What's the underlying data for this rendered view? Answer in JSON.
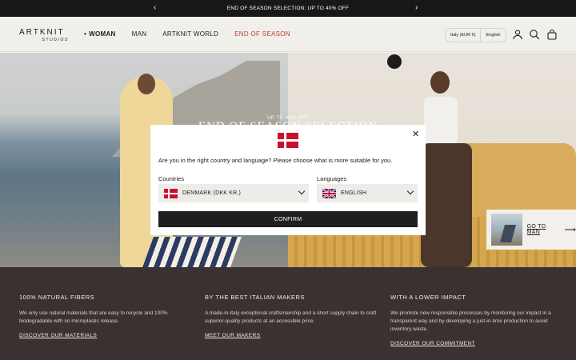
{
  "announcement": {
    "text": "END OF SEASON SELECTION: UP TO 40% OFF",
    "prev_icon": "chevron-left-icon",
    "next_icon": "chevron-right-icon",
    "prev_glyph": "‹",
    "next_glyph": "›"
  },
  "header": {
    "logo_main": "ARTKNIT",
    "logo_sub": "STUDIOS",
    "nav": [
      {
        "label": "WOMAN",
        "active": true
      },
      {
        "label": "MAN"
      },
      {
        "label": "ARTKNIT WORLD"
      },
      {
        "label": "END OF SEASON",
        "color": "#c0392b"
      }
    ],
    "region": "Italy (EUR €)",
    "language": "English",
    "icons": [
      "account-icon",
      "search-icon",
      "cart-icon"
    ]
  },
  "hero": {
    "subtitle": "UP TO 40% OFF",
    "title": "END OF SEASON SELECTION"
  },
  "man_card": {
    "label": "GO TO MAN",
    "arrow": "⟶"
  },
  "modal": {
    "close_glyph": "✕",
    "question": "Are you in the right country and language? Please choose what is more suitable for you.",
    "countries_label": "Countries",
    "country_value": "DENMARK (DKK KR.)",
    "languages_label": "Languages",
    "language_value": "ENGLISH",
    "confirm_label": "CONFIRM"
  },
  "features": [
    {
      "title": "100% NATURAL FIBERS",
      "text": "We only use natural materials that are easy to recycle and 100% biodegradable with no microplastic release.",
      "link": "DISCOVER OUR MATERIALS"
    },
    {
      "title": "BY THE BEST ITALIAN MAKERS",
      "text": "A made-in-Italy exceptional craftsmanship and a short supply chain to craft superior-quality products at an accessible price.",
      "link": "MEET OUR MAKERS"
    },
    {
      "title": "WITH A LOWER IMPACT",
      "text": "We promote new responsible processes by monitoring our impact in a transparent way and by developing a just-in-time production to avoid inventory waste.",
      "link": "DISCOVER OUR COMMITMENT"
    }
  ],
  "colors": {
    "announcement_bg": "#181818",
    "sale": "#c0392b",
    "footer_bg": "#3a3230",
    "confirm_bg": "#1f1f1f"
  }
}
